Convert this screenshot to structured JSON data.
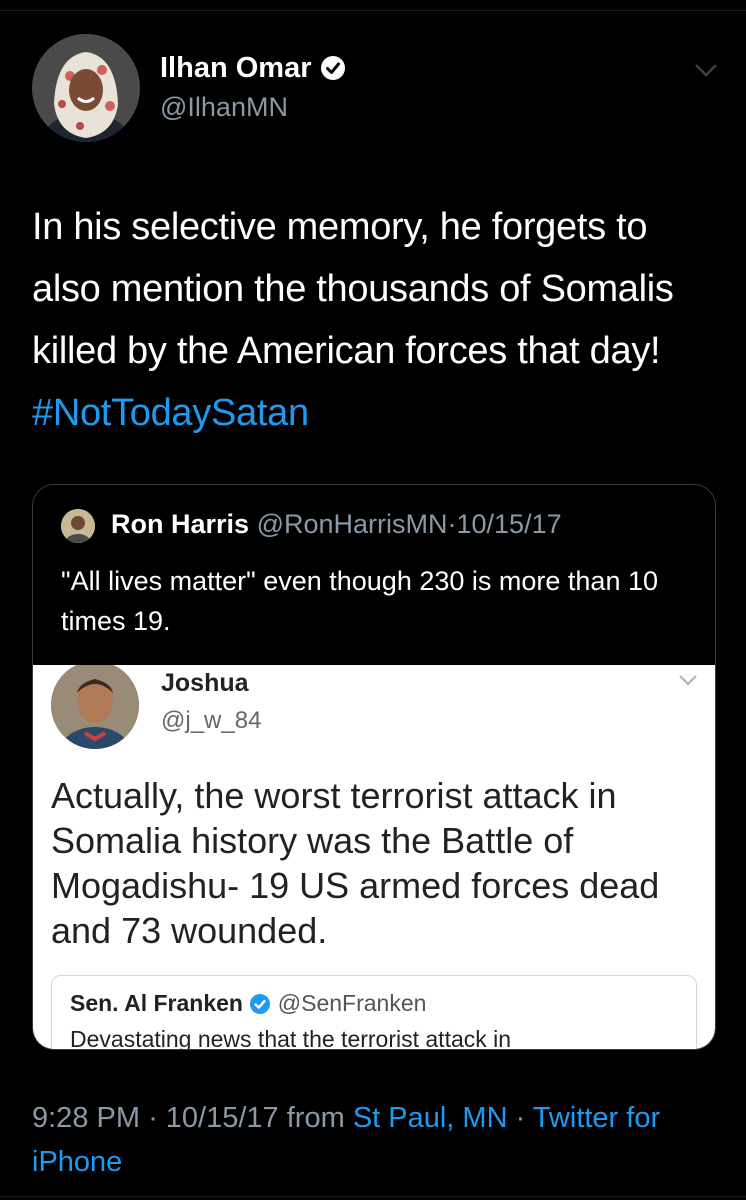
{
  "author": {
    "name": "Ilhan Omar",
    "handle": "@IlhanMN",
    "verified": true,
    "avatar": "profile-photo"
  },
  "tweet": {
    "text": "In his selective memory, he forgets to also mention the thousands of Somalis killed by the American forces that day!",
    "hashtag": "#NotTodaySatan"
  },
  "quoted": {
    "name": "Ron Harris",
    "handle": "@RonHarrisMN",
    "separator": "·",
    "date": "10/15/17",
    "text": "\"All lives matter\" even though 230 is more than 10 times 19."
  },
  "screenshot": {
    "name": "Joshua",
    "handle": "@j_w_84",
    "text": "Actually, the worst terrorist attack in Somalia history was the Battle of Mogadishu- 19 US armed forces dead and 73 wounded.",
    "nested": {
      "name": "Sen. Al Franken",
      "handle": "@SenFranken",
      "text": "Devastating news that the terrorist attack in"
    }
  },
  "meta": {
    "time": "9:28 PM",
    "date": "10/15/17",
    "from_label": "from",
    "location": "St Paul, MN",
    "source": "Twitter for iPhone",
    "separator": "·"
  },
  "colors": {
    "background": "#000000",
    "link": "#1d9bf0",
    "secondary_text": "#8b98a5"
  }
}
